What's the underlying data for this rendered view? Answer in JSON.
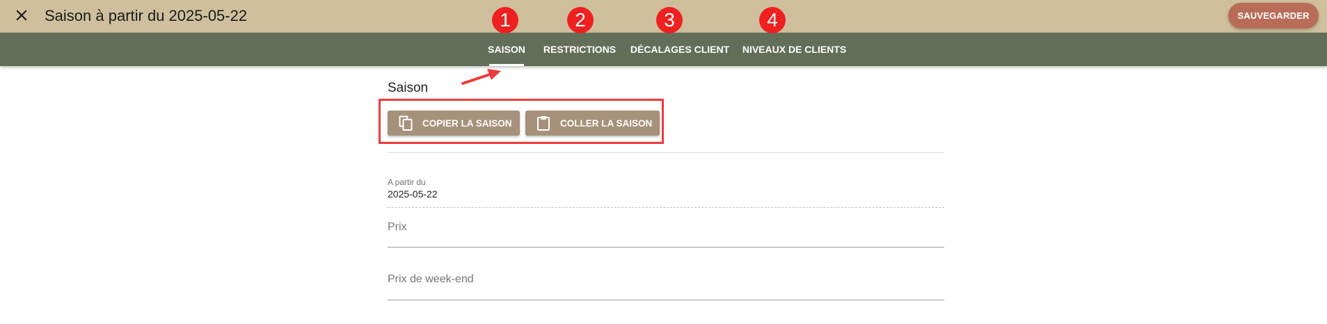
{
  "header": {
    "title": "Saison à partir du 2025-05-22",
    "close_icon": "close-icon",
    "save_label": "SAUVEGARDER"
  },
  "tabs": [
    {
      "label": "SAISON",
      "active": true
    },
    {
      "label": "RESTRICTIONS",
      "active": false
    },
    {
      "label": "DÉCALAGES CLIENT",
      "active": false
    },
    {
      "label": "NIVEAUX DE CLIENTS",
      "active": false
    }
  ],
  "annotations": {
    "badges": [
      "1",
      "2",
      "3",
      "4"
    ],
    "badge_color": "#ee2020",
    "highlight_color": "#ec3b3b"
  },
  "content": {
    "section_title": "Saison",
    "copy_button": {
      "label": "COPIER LA SAISON",
      "icon": "copy-icon"
    },
    "paste_button": {
      "label": "COLLER LA SAISON",
      "icon": "clipboard-icon"
    },
    "start_field": {
      "label": "A partir du",
      "value": "2025-05-22"
    },
    "price_field": {
      "placeholder": "Prix"
    },
    "weekend_price_field": {
      "placeholder": "Prix de week-end"
    }
  },
  "colors": {
    "topbar": "#cfbf9d",
    "tabbar": "#636e58",
    "save_button": "#b96d58",
    "action_button": "#a6917a"
  }
}
